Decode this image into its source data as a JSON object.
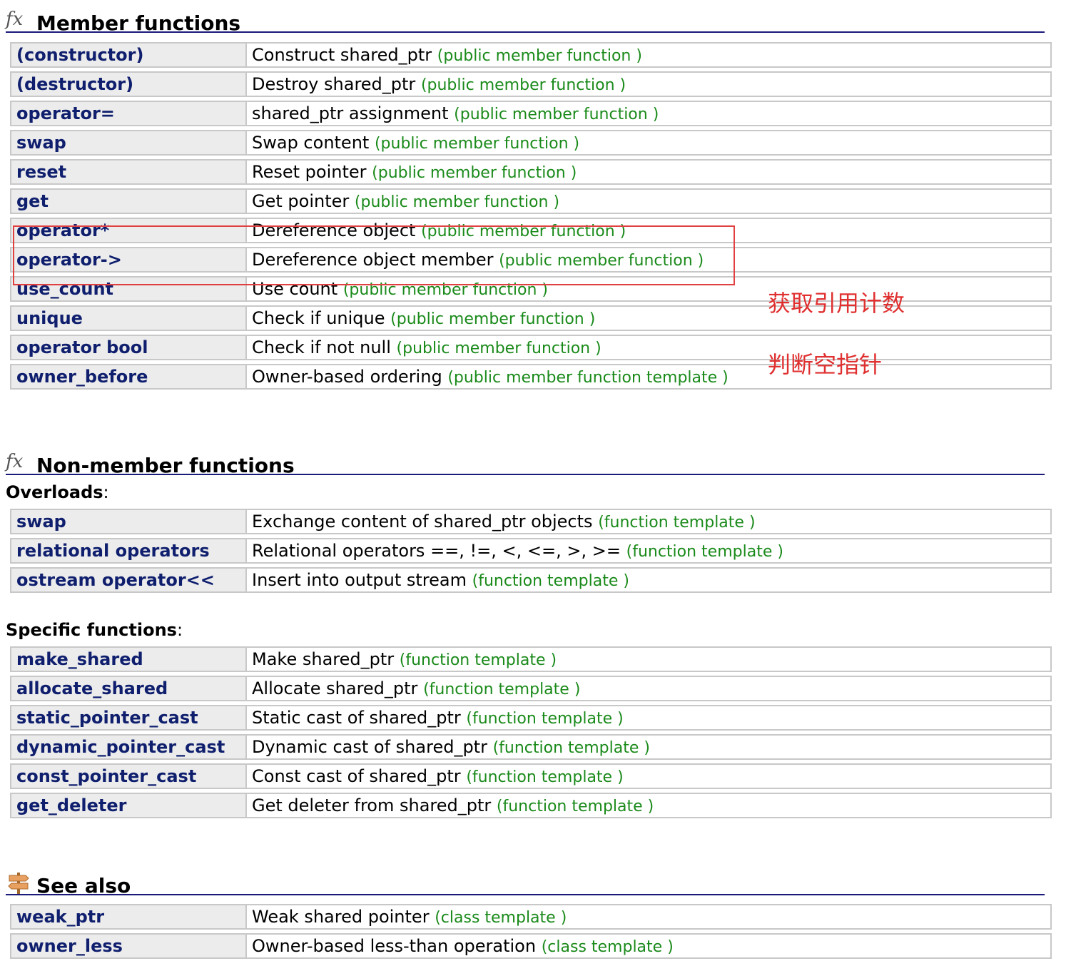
{
  "member_section": {
    "title": "Member functions",
    "icon": "fx-icon",
    "rows": [
      {
        "name": "(constructor)",
        "desc": "Construct shared_ptr",
        "kind": "(public member function )"
      },
      {
        "name": "(destructor)",
        "desc": "Destroy shared_ptr",
        "kind": "(public member function )"
      },
      {
        "name": "operator=",
        "desc": "shared_ptr assignment",
        "kind": "(public member function )"
      },
      {
        "name": "swap",
        "desc": "Swap content",
        "kind": "(public member function )"
      },
      {
        "name": "reset",
        "desc": "Reset pointer",
        "kind": "(public member function )"
      },
      {
        "name": "get",
        "desc": "Get pointer",
        "kind": "(public member function )"
      },
      {
        "name": "operator*",
        "desc": "Dereference object",
        "kind": "(public member function )"
      },
      {
        "name": "operator->",
        "desc": "Dereference object member",
        "kind": "(public member function )"
      },
      {
        "name": "use_count",
        "desc": "Use count",
        "kind": "(public member function )"
      },
      {
        "name": "unique",
        "desc": "Check if unique",
        "kind": "(public member function )"
      },
      {
        "name": "operator bool",
        "desc": "Check if not null",
        "kind": "(public member function )"
      },
      {
        "name": "owner_before",
        "desc": "Owner-based ordering",
        "kind": "(public member function template )"
      }
    ]
  },
  "annotations": {
    "use_count_note": "获取引用计数",
    "bool_note": "判断空指针"
  },
  "nonmember_section": {
    "title": "Non-member functions",
    "icon": "fx-icon",
    "overloads_label": "Overloads",
    "overloads": [
      {
        "name": "swap",
        "desc": "Exchange content of shared_ptr objects",
        "kind": "(function template )"
      },
      {
        "name": "relational operators",
        "desc": "Relational operators ==, !=, <, <=, >, >=",
        "kind": "(function template )"
      },
      {
        "name": "ostream operator<<",
        "desc": "Insert into output stream",
        "kind": "(function template )"
      }
    ],
    "specific_label": "Specific functions",
    "specific": [
      {
        "name": "make_shared",
        "desc": "Make shared_ptr",
        "kind": "(function template )"
      },
      {
        "name": "allocate_shared",
        "desc": "Allocate shared_ptr",
        "kind": "(function template )"
      },
      {
        "name": "static_pointer_cast",
        "desc": "Static cast of shared_ptr",
        "kind": "(function template )"
      },
      {
        "name": "dynamic_pointer_cast",
        "desc": "Dynamic cast of shared_ptr",
        "kind": "(function template )"
      },
      {
        "name": "const_pointer_cast",
        "desc": "Const cast of shared_ptr",
        "kind": "(function template )"
      },
      {
        "name": "get_deleter",
        "desc": "Get deleter from shared_ptr",
        "kind": "(function template )"
      }
    ]
  },
  "see_also_section": {
    "title": "See also",
    "icon": "signpost-icon",
    "rows": [
      {
        "name": "weak_ptr",
        "desc": "Weak shared pointer",
        "kind": "(class template )"
      },
      {
        "name": "owner_less",
        "desc": "Owner-based less-than operation",
        "kind": "(class template )"
      }
    ]
  },
  "colors": {
    "link": "#0f1f6e",
    "kind": "#1a8a1a",
    "annotation": "#e03030",
    "header_rule": "#1a1a7a"
  }
}
